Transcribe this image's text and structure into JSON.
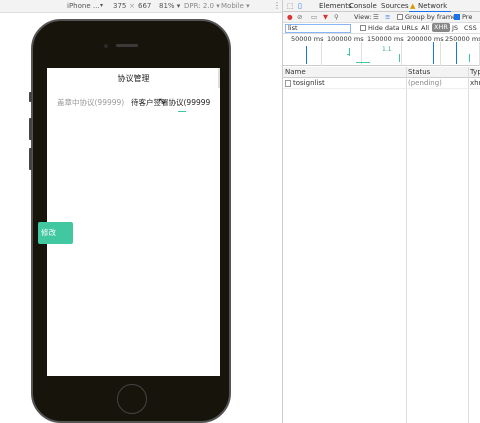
{
  "device_toolbar": {
    "model": "iPhone ...",
    "caret": "▾",
    "width": "375",
    "x": "×",
    "height": "667",
    "zoom": "81% ▾",
    "dpr": "DPR: 2.0 ▾",
    "mode": "Mobile ▾",
    "more": "⋮"
  },
  "app": {
    "title": "协议管理",
    "tabs": [
      {
        "label": "盖章中协议(99999)"
      },
      {
        "label": "待客户签署协议(99999"
      }
    ],
    "float_button": "修改"
  },
  "devtools": {
    "tabs": {
      "elements": "Elements",
      "console": "Console",
      "sources": "Sources",
      "warning": "▲",
      "network": "Network"
    },
    "toolbar": {
      "view_label": "View:",
      "group_by_frame": "Group by frame",
      "preserve": "Pre"
    },
    "filter": {
      "value": "list",
      "hide_data_urls": "Hide data URLs",
      "all": "All",
      "xhr": "XHR",
      "js": "JS",
      "css": "CSS"
    },
    "timeline": {
      "ticks": [
        "50000 ms",
        "100000 ms",
        "150000 ms",
        "200000 ms",
        "250000 ms"
      ],
      "label": "1.1"
    },
    "table": {
      "headers": {
        "name": "Name",
        "status": "Status",
        "type": "Typ"
      },
      "rows": [
        {
          "name": "tosignlist",
          "status": "(pending)",
          "type": "xhr"
        }
      ]
    }
  }
}
